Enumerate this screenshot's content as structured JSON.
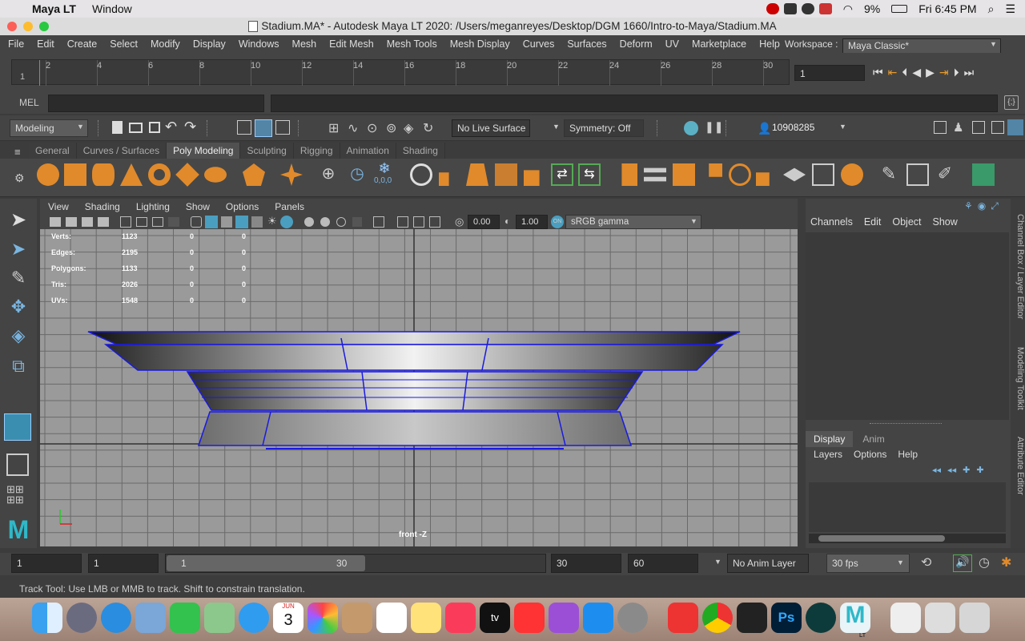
{
  "macos": {
    "app_name": "Maya LT",
    "menu_window": "Window",
    "battery": "9%",
    "clock": "Fri 6:45 PM"
  },
  "window": {
    "title": "Stadium.MA* - Autodesk Maya LT 2020: /Users/meganreyes/Desktop/DGM 1660/Intro-to-Maya/Stadium.MA"
  },
  "menubar": {
    "items": [
      "File",
      "Edit",
      "Create",
      "Select",
      "Modify",
      "Display",
      "Windows",
      "Mesh",
      "Edit Mesh",
      "Mesh Tools",
      "Mesh Display",
      "Curves",
      "Surfaces",
      "Deform",
      "UV",
      "Marketplace",
      "Help"
    ],
    "workspace_label": "Workspace :",
    "workspace_value": "Maya Classic*"
  },
  "timeline": {
    "ticks": [
      "2",
      "4",
      "6",
      "8",
      "10",
      "12",
      "14",
      "16",
      "18",
      "20",
      "22",
      "24",
      "26",
      "28",
      "30"
    ],
    "start_marker": "1",
    "current_frame": "1"
  },
  "command_line": {
    "mel_label": "MEL"
  },
  "status_line": {
    "mode": "Modeling",
    "live_surface": "No Live Surface",
    "symmetry": "Symmetry: Off",
    "user_id": "10908285"
  },
  "shelf": {
    "tabs": [
      "General",
      "Curves / Surfaces",
      "Poly Modeling",
      "Sculpting",
      "Rigging",
      "Animation",
      "Shading"
    ],
    "active_tab": "Poly Modeling",
    "zero_label": "0,0,0"
  },
  "viewport_panel": {
    "menu": [
      "View",
      "Shading",
      "Lighting",
      "Show",
      "Options",
      "Panels"
    ],
    "exposure": "0.00",
    "gamma": "1.00",
    "color_space": "sRGB gamma",
    "camera_label": "front -Z"
  },
  "hud": {
    "rows": [
      {
        "label": "Verts:",
        "values": [
          "1123",
          "0",
          "0"
        ]
      },
      {
        "label": "Edges:",
        "values": [
          "2195",
          "0",
          "0"
        ]
      },
      {
        "label": "Polygons:",
        "values": [
          "1133",
          "0",
          "0"
        ]
      },
      {
        "label": "Tris:",
        "values": [
          "2026",
          "0",
          "0"
        ]
      },
      {
        "label": "UVs:",
        "values": [
          "1548",
          "0",
          "0"
        ]
      }
    ]
  },
  "channel_box": {
    "menu": [
      "Channels",
      "Edit",
      "Object",
      "Show"
    ]
  },
  "layer_editor": {
    "tabs": [
      "Display",
      "Anim"
    ],
    "menu": [
      "Layers",
      "Options",
      "Help"
    ]
  },
  "side_tabs": [
    "Channel Box / Layer Editor",
    "Modeling Toolkit",
    "Attribute Editor"
  ],
  "range": {
    "start": "1",
    "playback_start": "1",
    "slider_start": "1",
    "slider_end": "30",
    "playback_end": "30",
    "end": "60",
    "anim_layer": "No Anim Layer",
    "fps": "30 fps"
  },
  "help_line": "Track Tool: Use LMB or MMB to track. Shift to constrain translation.",
  "dock_calendar": {
    "month": "JUN",
    "day": "3"
  },
  "dock_apptv": "tv",
  "dock_ps": "Ps",
  "dock_mayalt": "LT"
}
